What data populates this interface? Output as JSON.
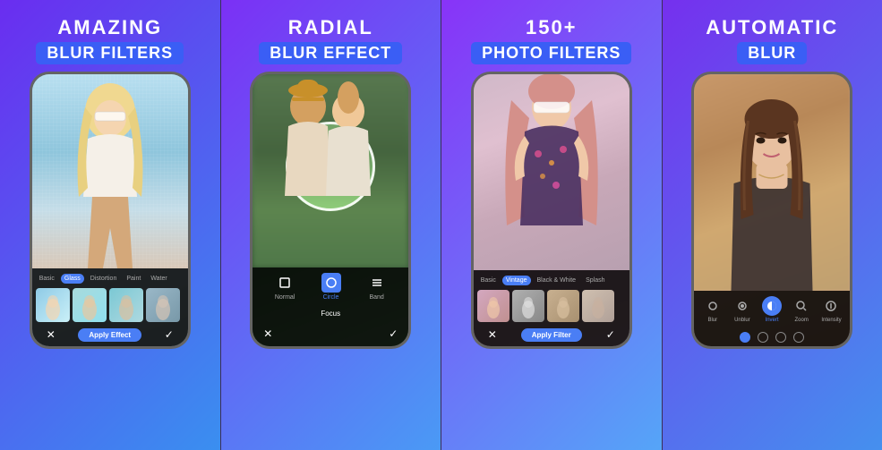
{
  "panels": [
    {
      "id": "panel1",
      "title_line1": "AMAZING",
      "title_line2": "BLUR FILTERS",
      "filter_tabs": [
        "Basic",
        "Glass",
        "Distortion",
        "Paint",
        "Water"
      ],
      "active_tab": "Glass",
      "apply_label": "Apply Effect"
    },
    {
      "id": "panel2",
      "title_line1": "RADIAL",
      "title_line2": "BLUR EFFECT",
      "modes": [
        "Normal",
        "Circle",
        "Band"
      ],
      "active_mode": "Circle",
      "focus_label": "Focus"
    },
    {
      "id": "panel3",
      "title_line1": "150+",
      "title_line2": "PHOTO FILTERS",
      "filter_tabs": [
        "Basic",
        "Vintage",
        "Black & White",
        "Splash"
      ],
      "active_tab": "Vintage",
      "apply_label": "Apply Filter"
    },
    {
      "id": "panel4",
      "title_line1": "AUTOMATIC",
      "title_line2": "BLUR",
      "tools": [
        "Blur",
        "Unblur",
        "Invert",
        "Zoom",
        "Intensity"
      ],
      "active_tool": "Invert"
    }
  ],
  "icons": {
    "close": "✕",
    "check": "✓",
    "normal_square": "□",
    "circle": "◯",
    "band": "⠿"
  }
}
